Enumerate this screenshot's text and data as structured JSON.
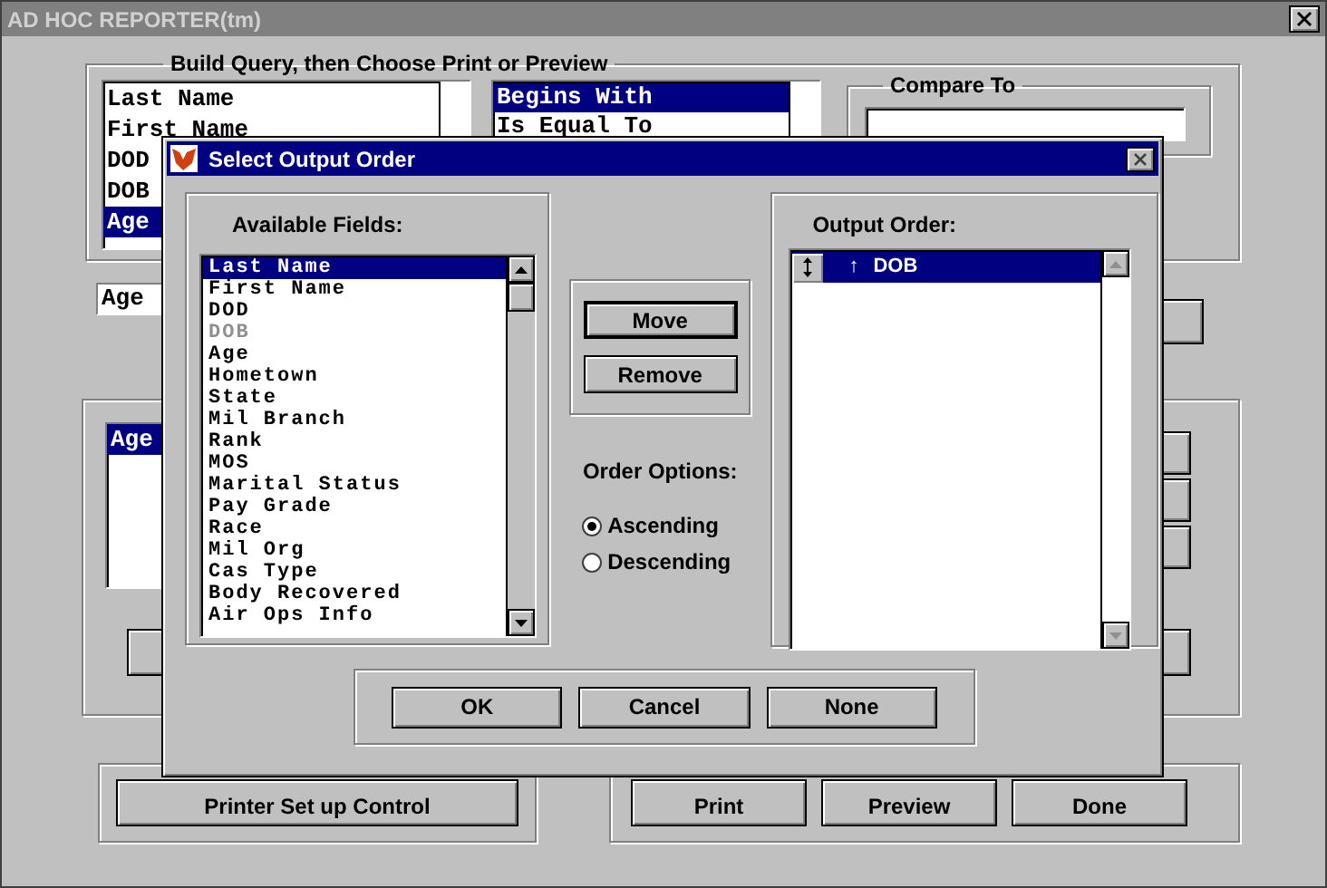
{
  "window": {
    "title": "AD HOC REPORTER(tm)"
  },
  "query": {
    "title": "Build Query, then Choose Print or Preview",
    "fields": [
      {
        "label": "Last Name",
        "selected": false
      },
      {
        "label": "First Name",
        "selected": false
      },
      {
        "label": "DOD",
        "selected": false
      },
      {
        "label": "DOB",
        "selected": false
      },
      {
        "label": "Age",
        "selected": true
      }
    ],
    "operators": [
      {
        "label": "Begins With",
        "selected": true
      },
      {
        "label": "Is Equal To",
        "selected": false
      }
    ],
    "compare": {
      "title": "Compare To"
    }
  },
  "criteria_label": "Age",
  "criteria_list": [
    {
      "label": "Age",
      "selected": true
    }
  ],
  "bottom_buttons": [
    "Printer Set up Control",
    "Print",
    "Preview",
    "Done"
  ],
  "dialog": {
    "title": "Select Output Order",
    "available": {
      "title": "Available Fields:",
      "items": [
        {
          "label": "Last Name",
          "selected": true,
          "disabled": false
        },
        {
          "label": "First Name",
          "selected": false,
          "disabled": false
        },
        {
          "label": "DOD",
          "selected": false,
          "disabled": false
        },
        {
          "label": "DOB",
          "selected": false,
          "disabled": true
        },
        {
          "label": "Age",
          "selected": false,
          "disabled": false
        },
        {
          "label": "Hometown",
          "selected": false,
          "disabled": false
        },
        {
          "label": "State",
          "selected": false,
          "disabled": false
        },
        {
          "label": "Mil Branch",
          "selected": false,
          "disabled": false
        },
        {
          "label": "Rank",
          "selected": false,
          "disabled": false
        },
        {
          "label": "MOS",
          "selected": false,
          "disabled": false
        },
        {
          "label": "Marital Status",
          "selected": false,
          "disabled": false
        },
        {
          "label": "Pay Grade",
          "selected": false,
          "disabled": false
        },
        {
          "label": "Race",
          "selected": false,
          "disabled": false
        },
        {
          "label": "Mil Org",
          "selected": false,
          "disabled": false
        },
        {
          "label": "Cas Type",
          "selected": false,
          "disabled": false
        },
        {
          "label": "Body Recovered",
          "selected": false,
          "disabled": false
        },
        {
          "label": "Air Ops Info",
          "selected": false,
          "disabled": false
        }
      ]
    },
    "actions": [
      {
        "label": "Move",
        "default": true
      },
      {
        "label": "Remove",
        "default": false
      }
    ],
    "order_options": {
      "title": "Order Options:",
      "options": [
        {
          "label": "Ascending",
          "selected": true
        },
        {
          "label": "Descending",
          "selected": false
        }
      ]
    },
    "output": {
      "title": "Output Order:",
      "items": [
        {
          "arrow": "↑",
          "label": "DOB",
          "selected": true
        }
      ]
    },
    "buttons": [
      "OK",
      "Cancel",
      "None"
    ]
  }
}
